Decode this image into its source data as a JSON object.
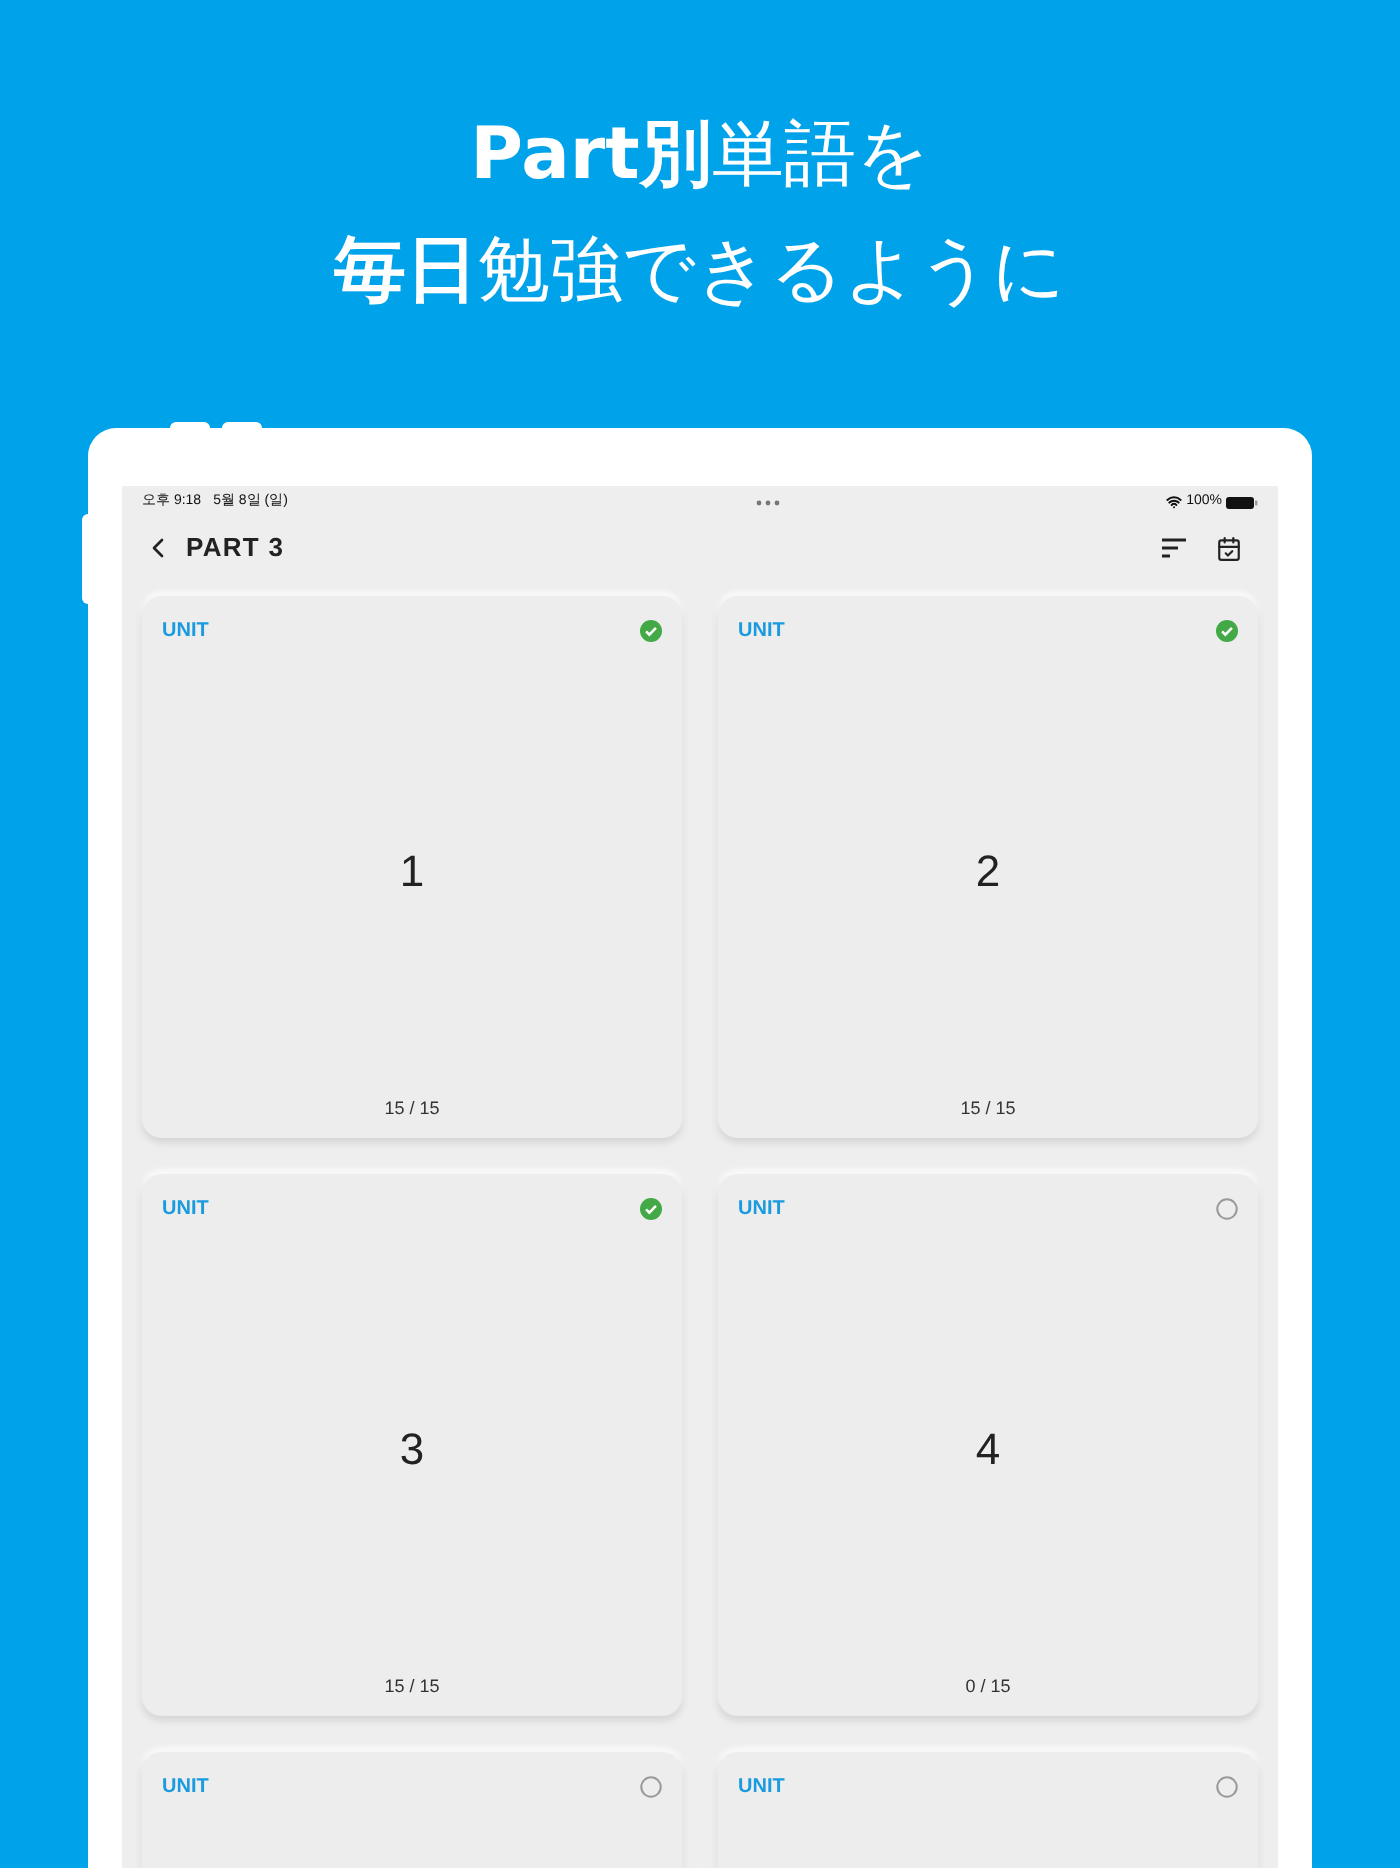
{
  "headline": [
    "**Part別**単語を",
    "**毎日**勉強できるように"
  ],
  "status_bar": {
    "time": "오후 9:18",
    "date": "5월 8일 (일)",
    "battery": "100%"
  },
  "nav": {
    "title": "PART 3"
  },
  "units": [
    {
      "label": "UNIT",
      "number": "1",
      "count": "15 / 15",
      "done": true
    },
    {
      "label": "UNIT",
      "number": "2",
      "count": "15 / 15",
      "done": true
    },
    {
      "label": "UNIT",
      "number": "3",
      "count": "15 / 15",
      "done": true
    },
    {
      "label": "UNIT",
      "number": "4",
      "count": "0 / 15",
      "done": false
    },
    {
      "label": "UNIT",
      "done": false
    },
    {
      "label": "UNIT",
      "done": false
    }
  ]
}
